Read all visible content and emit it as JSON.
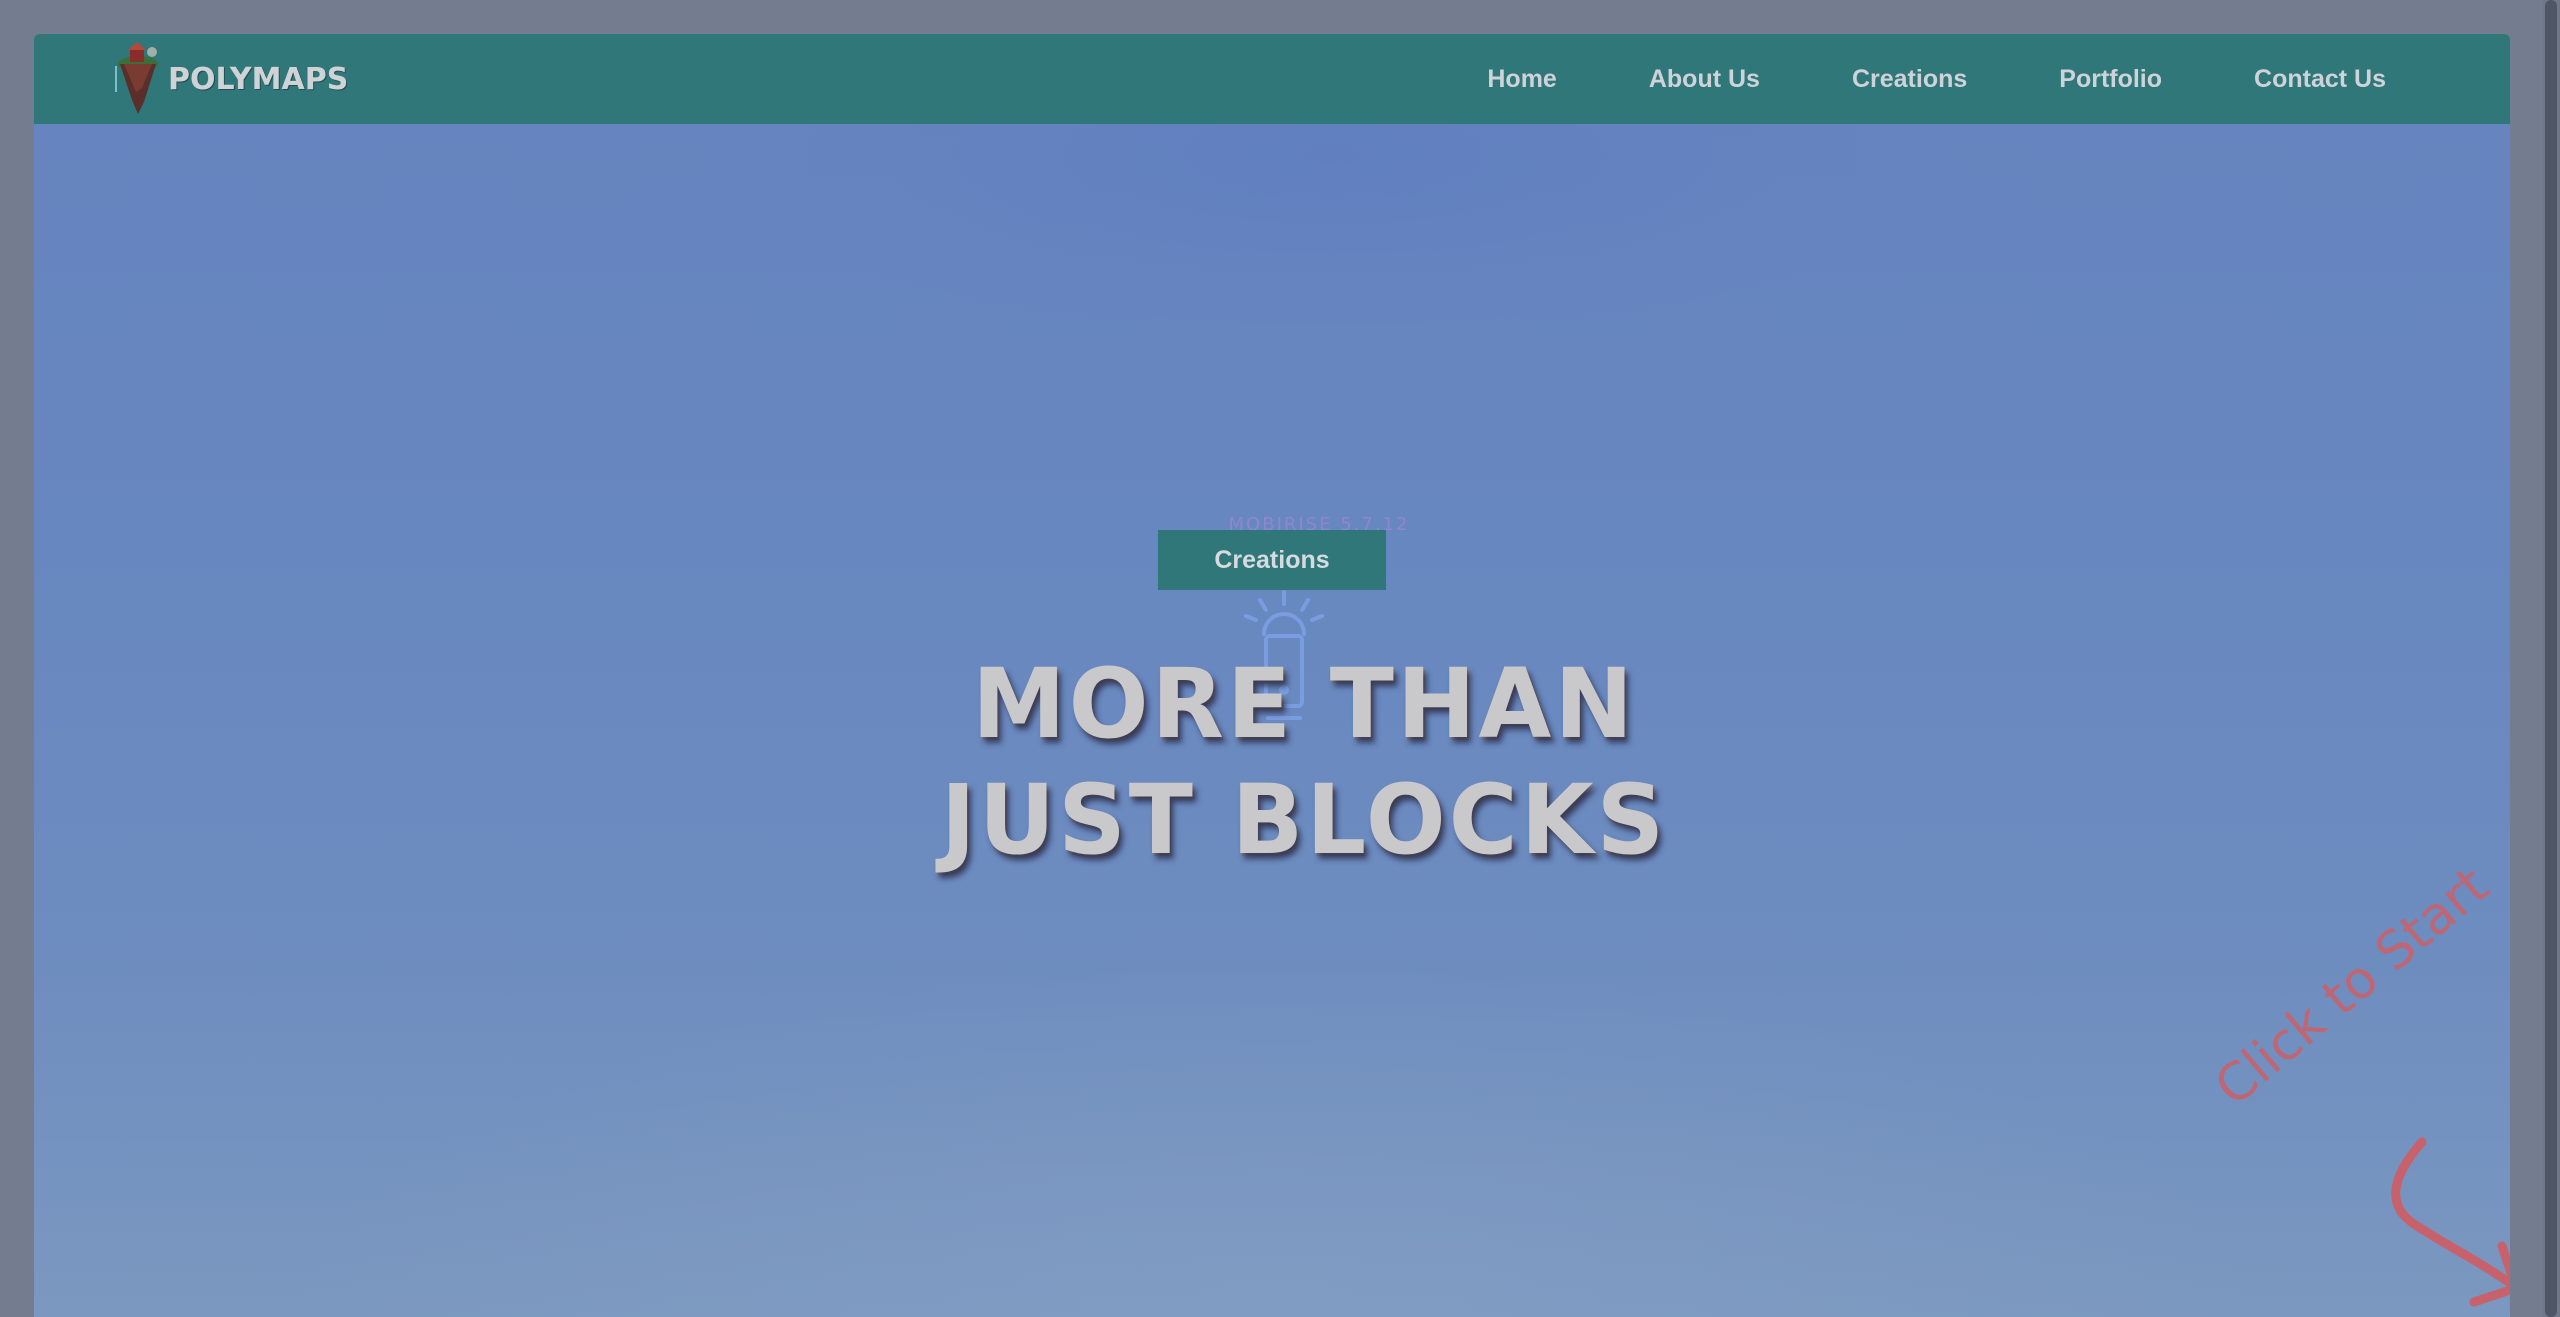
{
  "brand": {
    "name": "POLYMAPS",
    "logo_icon": "floating-island-logo"
  },
  "nav": {
    "items": [
      {
        "label": "Home"
      },
      {
        "label": "About Us"
      },
      {
        "label": "Creations"
      },
      {
        "label": "Portfolio"
      },
      {
        "label": "Contact Us"
      }
    ]
  },
  "hero": {
    "version_label": "MOBIRISE 5.7.12",
    "cta_label": "Creations",
    "title_line_1": "MORE THAN",
    "title_line_2": "JUST BLOCKS",
    "icon": "lightbulb-icon"
  },
  "hint": {
    "text": "Click to Start",
    "fab_symbol": "+"
  },
  "colors": {
    "navbar": "#30777a",
    "sky": "#6684bf",
    "accent_red": "#c95560",
    "title": "#c9c9cc"
  }
}
